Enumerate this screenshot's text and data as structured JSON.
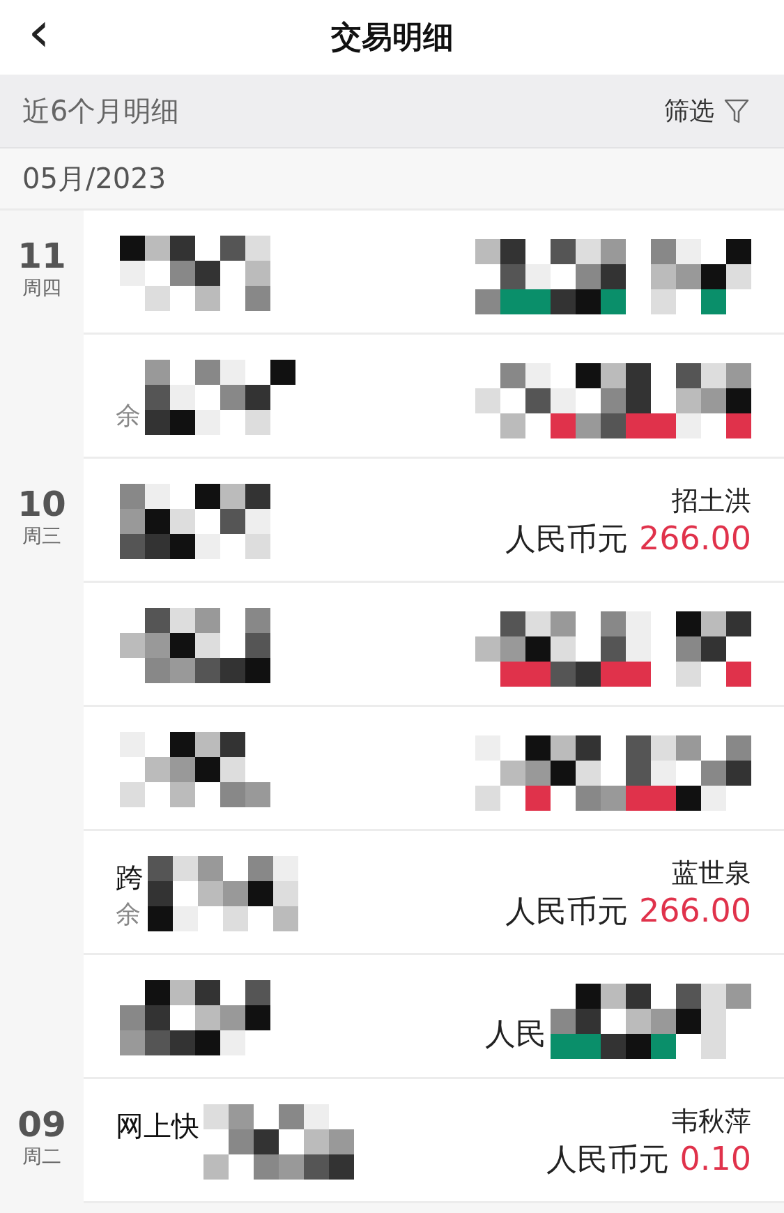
{
  "header": {
    "back_icon": "‹",
    "title": "交易明细"
  },
  "filter_bar": {
    "label": "近6个月明细",
    "filter_label": "筛选"
  },
  "month": "05月/2023",
  "groups": [
    {
      "day": "11",
      "weekday": "周四",
      "rows": [
        {
          "color": "#0a8f6a"
        },
        {
          "subtitle": "余",
          "color": "#e0324b"
        }
      ]
    },
    {
      "day": "10",
      "weekday": "周三",
      "rows": [
        {
          "payee": "招土洪",
          "currency": "人民币元",
          "amount": "266.00",
          "color": "#e0324b"
        },
        {
          "color": "#e0324b"
        },
        {
          "color": "#e0324b"
        },
        {
          "title": "跨",
          "subtitle": "余",
          "payee": "蓝世泉",
          "currency": "人民币元",
          "amount": "266.00",
          "color": "#e0324b"
        },
        {
          "currency": "人民",
          "color": "#0a8f6a"
        }
      ]
    },
    {
      "day": "09",
      "weekday": "周二",
      "rows": [
        {
          "title": "网上快",
          "payee": "韦秋萍",
          "currency": "人民币元",
          "amount": "0.10",
          "color": "#e0324b"
        }
      ]
    }
  ]
}
